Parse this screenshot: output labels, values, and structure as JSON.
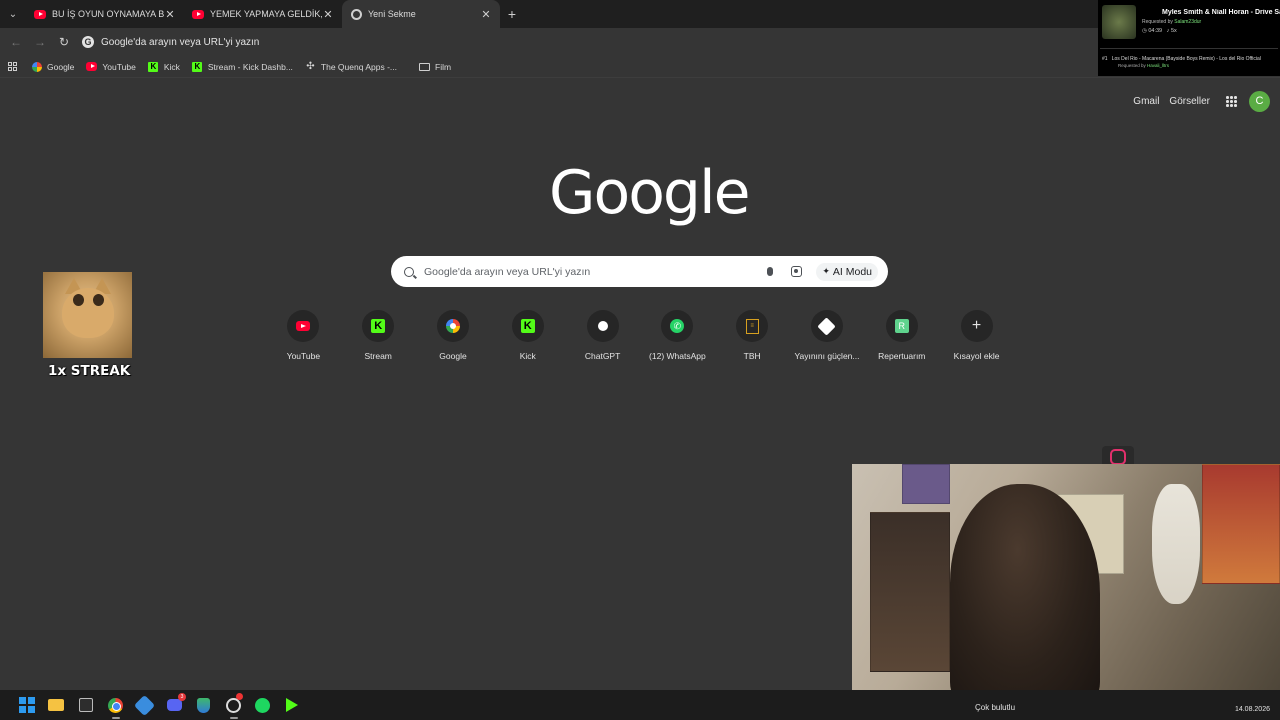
{
  "tabs": [
    {
      "title": "BU İŞ OYUN OYNAMAYA BENZ",
      "icon": "youtube-icon"
    },
    {
      "title": "YEMEK YAPMAYA GELDİK, DAYA",
      "icon": "youtube-icon"
    },
    {
      "title": "Yeni Sekme",
      "icon": "chrome-icon"
    }
  ],
  "omnibox": {
    "text": "Google'da arayın veya URL'yi yazın"
  },
  "bookmarks": [
    {
      "label": "Google"
    },
    {
      "label": "YouTube"
    },
    {
      "label": "Kick"
    },
    {
      "label": "Stream - Kick Dashb..."
    },
    {
      "label": "The Quenq Apps -..."
    },
    {
      "label": "Film"
    }
  ],
  "header_links": {
    "gmail": "Gmail",
    "images": "Görseller",
    "avatar_letter": "C"
  },
  "logo_text": "Google",
  "search": {
    "placeholder": "Google'da arayın veya URL'yi yazın",
    "ai_mode": "AI Modu"
  },
  "shortcuts": [
    {
      "label": "YouTube"
    },
    {
      "label": "Stream"
    },
    {
      "label": "Google"
    },
    {
      "label": "Kick"
    },
    {
      "label": "ChatGPT"
    },
    {
      "label": "(12) WhatsApp"
    },
    {
      "label": "TBH"
    },
    {
      "label": "Yayınını güçlen..."
    },
    {
      "label": "Repertuarım"
    },
    {
      "label": "Kısayol ekle"
    }
  ],
  "streak": "1x STREAK",
  "now_playing": {
    "title": "Myles Smith & Niall Horan - Drive Safe",
    "requested_by_label": "Requested by",
    "requested_by": "Salam23dur",
    "time": "04:39",
    "count": "5x",
    "next_index": "#1",
    "next_title": "Los Del Rio - Macarena (Bayside Boys Remix) - Los del Rio Official",
    "next_requested_by": "Havali_lltrs"
  },
  "taskbar": {
    "discord_badge": "3",
    "tray_text": "Çok bulutlu",
    "date": "14.08.2026"
  },
  "colors": {
    "background": "#353535",
    "tabstrip": "#1f1f1f",
    "accent_green": "#5aac44",
    "kick": "#53fc18",
    "youtube": "#ff0033"
  }
}
